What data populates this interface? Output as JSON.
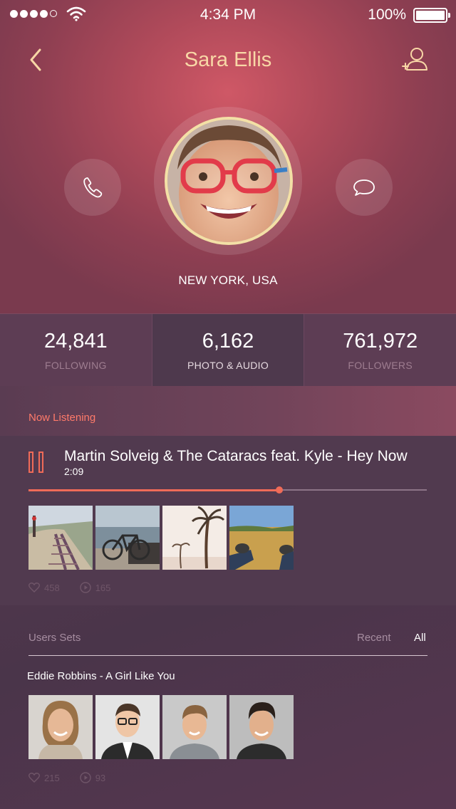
{
  "status_bar": {
    "time": "4:34 PM",
    "battery_percent": "100%",
    "signal_bars": 4
  },
  "header": {
    "title": "Sara Ellis",
    "back_icon": "chevron-left-icon",
    "add_user_icon": "add-user-icon"
  },
  "profile": {
    "location": "NEW YORK, USA",
    "call_icon": "phone-icon",
    "message_icon": "chat-bubble-icon"
  },
  "stats": [
    {
      "value": "24,841",
      "label": "FOLLOWING",
      "active": false
    },
    {
      "value": "6,162",
      "label": "PHOTO & AUDIO",
      "active": true
    },
    {
      "value": "761,972",
      "label": "FOLLOWERS",
      "active": false
    }
  ],
  "now_listening": {
    "label": "Now Listening",
    "track": "Martin Solveig & The Cataracs feat. Kyle - Hey Now",
    "time": "2:09",
    "progress": 0.63,
    "likes": "458",
    "plays": "165"
  },
  "users_sets": {
    "label": "Users Sets",
    "tab_recent": "Recent",
    "tab_all": "All",
    "set_title": "Eddie Robbins - A Girl Like You",
    "likes": "215",
    "plays": "93"
  },
  "colors": {
    "accent": "#f06b58",
    "title": "#f8d7a6"
  }
}
